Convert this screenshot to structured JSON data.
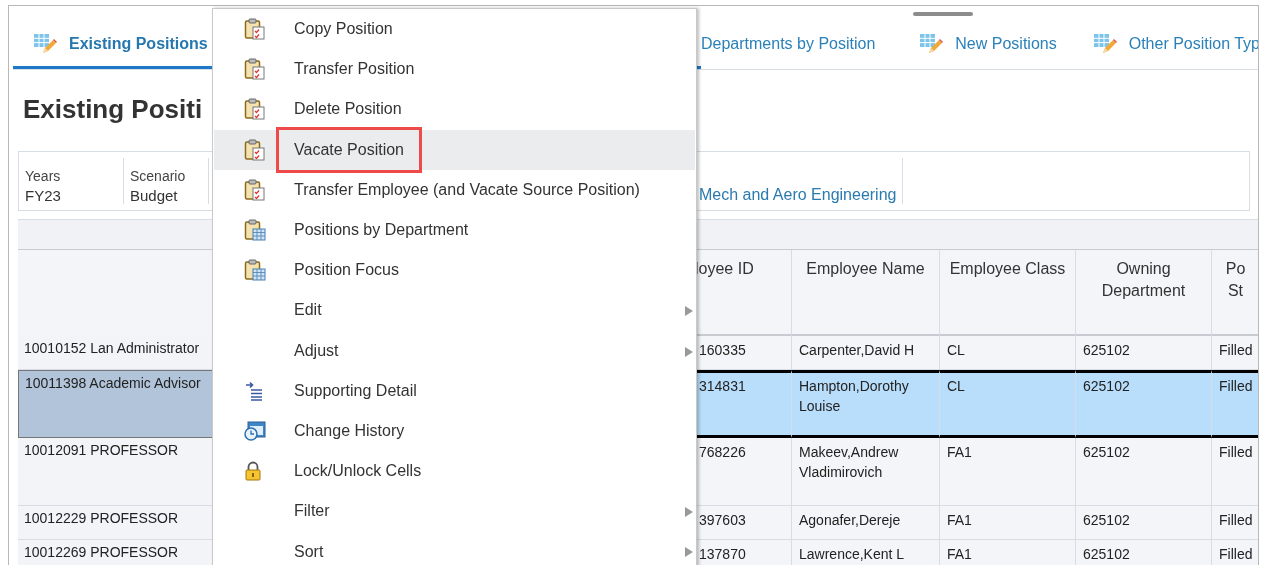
{
  "tabs": [
    {
      "label": "Existing Positions",
      "icon": true,
      "selected": true
    },
    {
      "label": "Departments by Position",
      "icon": false,
      "selected": false
    },
    {
      "label": "New Positions",
      "icon": true,
      "selected": false
    },
    {
      "label": "Other Position Typ",
      "icon": true,
      "selected": false
    }
  ],
  "heading": "Existing Positi",
  "pov": [
    {
      "label": "Years",
      "value": "FY23",
      "link": false
    },
    {
      "label": "Scenario",
      "value": "Budget",
      "link": false
    },
    {
      "value": "Mech and Aero Engineering",
      "link": true
    }
  ],
  "table": {
    "columns": [
      "loyee ID",
      "Employee Name",
      "Employee Class",
      "Owning Department",
      "Po St"
    ],
    "rows": [
      {
        "header": "10010152 Lan Administrator",
        "cells": [
          "160335",
          "Carpenter,David H",
          "CL",
          "625102",
          "Filled"
        ],
        "selected": false
      },
      {
        "header": "10011398 Academic Advisor",
        "cells": [
          "314831",
          "Hampton,Dorothy Louise",
          "CL",
          "625102",
          "Filled"
        ],
        "selected": true
      },
      {
        "header": "10012091 PROFESSOR",
        "cells": [
          "768226",
          "Makeev,Andrew Vladimirovich",
          "FA1",
          "625102",
          "Filled"
        ],
        "selected": false
      },
      {
        "header": "10012229 PROFESSOR",
        "cells": [
          "397603",
          "Agonafer,Dereje",
          "FA1",
          "625102",
          "Filled"
        ],
        "selected": false
      },
      {
        "header": "10012269 PROFESSOR",
        "cells": [
          "137870",
          "Lawrence,Kent L",
          "FA1",
          "625102",
          "Filled"
        ],
        "selected": false
      }
    ]
  },
  "context_menu": [
    {
      "label": "Copy Position",
      "kind": "check",
      "submenu": false,
      "selected": false,
      "outlined": false
    },
    {
      "label": "Transfer Position",
      "kind": "check",
      "submenu": false,
      "selected": false,
      "outlined": false
    },
    {
      "label": "Delete Position",
      "kind": "check",
      "submenu": false,
      "selected": false,
      "outlined": false
    },
    {
      "label": "Vacate Position",
      "kind": "check",
      "submenu": false,
      "selected": true,
      "outlined": true
    },
    {
      "label": "Transfer Employee (and Vacate Source Position)",
      "kind": "check",
      "submenu": false,
      "selected": false,
      "outlined": false
    },
    {
      "label": "Positions by Department",
      "kind": "grid",
      "submenu": false,
      "selected": false,
      "outlined": false
    },
    {
      "label": "Position Focus",
      "kind": "grid",
      "submenu": false,
      "selected": false,
      "outlined": false
    },
    {
      "label": "Edit",
      "kind": "plain",
      "submenu": true,
      "selected": false,
      "outlined": false
    },
    {
      "label": "Adjust",
      "kind": "plain",
      "submenu": true,
      "selected": false,
      "outlined": false
    },
    {
      "label": "Supporting Detail",
      "kind": "detail",
      "submenu": false,
      "selected": false,
      "outlined": false
    },
    {
      "label": "Change History",
      "kind": "history",
      "submenu": false,
      "selected": false,
      "outlined": false
    },
    {
      "label": "Lock/Unlock Cells",
      "kind": "lock",
      "submenu": false,
      "selected": false,
      "outlined": false
    },
    {
      "label": "Filter",
      "kind": "plain",
      "submenu": true,
      "selected": false,
      "outlined": false
    },
    {
      "label": "Sort",
      "kind": "plain",
      "submenu": true,
      "selected": false,
      "outlined": false
    }
  ]
}
